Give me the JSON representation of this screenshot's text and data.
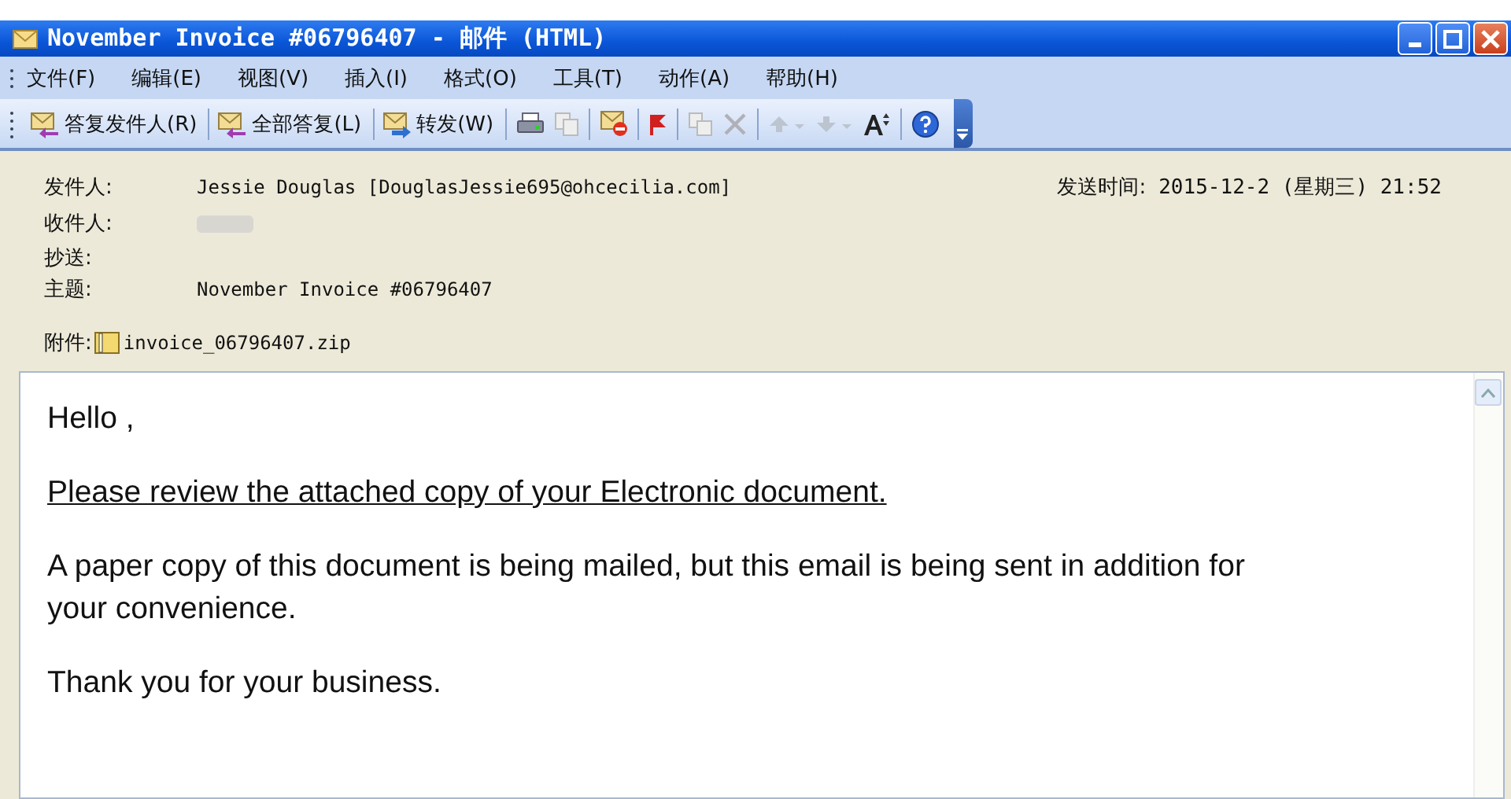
{
  "window": {
    "title": "November Invoice #06796407 - 邮件 (HTML)"
  },
  "menu": [
    "文件(F)",
    "编辑(E)",
    "视图(V)",
    "插入(I)",
    "格式(O)",
    "工具(T)",
    "动作(A)",
    "帮助(H)"
  ],
  "toolbar": [
    "答复发件人(R)",
    "全部答复(L)",
    "转发(W)"
  ],
  "header": {
    "from_label": "发件人:",
    "from": "Jessie Douglas [DouglasJessie695@ohcecilia.com]",
    "sent_label": "发送时间:",
    "sent": "2015-12-2 (星期三) 21:52",
    "to_label": "收件人:",
    "cc_label": "抄送:",
    "subject_label": "主题:",
    "subject": "November Invoice #06796407",
    "attachment_label": "附件:",
    "attachment": "invoice_06796407.zip"
  },
  "message": [
    {
      "kind": "plain",
      "text": "Hello ,"
    },
    {
      "kind": "link",
      "text": "Please review the attached copy of your Electronic document."
    },
    {
      "kind": "plain",
      "text": "A paper copy of this document is being mailed, but this email is being sent in addition for your convenience."
    },
    {
      "kind": "plain",
      "text": "Thank you for your business."
    }
  ]
}
